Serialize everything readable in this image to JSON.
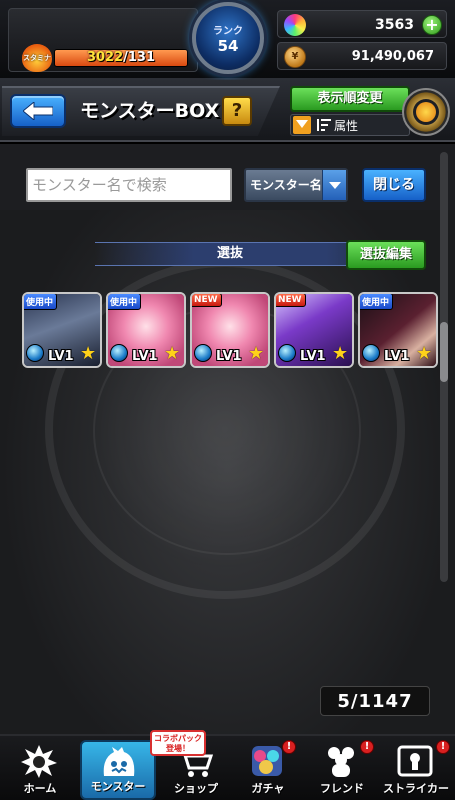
{
  "top": {
    "stamina_label": "スタミナ",
    "stamina_current": "3022",
    "stamina_max": "/131",
    "stamina_fill": 1.0,
    "rank_label": "ランク",
    "rank_value": "54",
    "orbs": "3563",
    "gold": "91,490,067"
  },
  "header": {
    "title": "モンスターBOX",
    "help": "?",
    "sort_button": "表示順変更",
    "filter_label": "属性"
  },
  "search": {
    "placeholder": "モンスター名で検索",
    "field_option": "モンスター名",
    "close_button": "閉じる"
  },
  "team": {
    "label": "選抜",
    "edit_button": "選抜編集"
  },
  "monsters": [
    {
      "tag": "使用中",
      "level": "LV1",
      "color": "#3a4a6a"
    },
    {
      "tag": "使用中",
      "level": "LV1",
      "color": "#e87aa0"
    },
    {
      "tag": "NEW",
      "level": "LV1",
      "color": "#e87aa0"
    },
    {
      "tag": "NEW",
      "level": "LV1",
      "color": "#6a3aa8"
    },
    {
      "tag": "使用中",
      "level": "LV1",
      "color": "#2a1a2a"
    }
  ],
  "box_count": "5/1147",
  "nav": {
    "home": "ホーム",
    "monster": "モンスター",
    "shop": "ショップ",
    "gacha": "ガチャ",
    "friend": "フレンド",
    "striker": "ストライカー",
    "collab_badge_line1": "コラボパック",
    "collab_badge_line2": "登場！",
    "alert": "!"
  }
}
